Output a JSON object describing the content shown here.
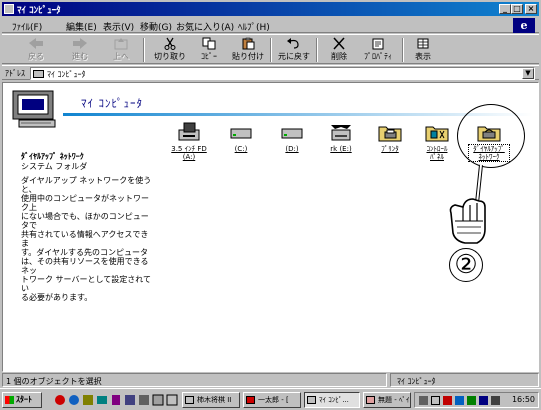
{
  "window": {
    "title": "ﾏｲ ｺﾝﾋﾟｭｰﾀ",
    "controls": {
      "minimize": "_",
      "maximize": "□",
      "close": "×"
    }
  },
  "menu": [
    "ﾌｧｲﾙ(F)",
    "編集(E)",
    "表示(V)",
    "移動(G)",
    "お気に入り(A)",
    "ﾍﾙﾌﾟ(H)"
  ],
  "toolbar": {
    "back": "戻る",
    "forward": "進む",
    "up": "上へ",
    "cut": "切り取り",
    "copy": "ｺﾋﾟｰ",
    "paste": "貼り付け",
    "undo": "元に戻す",
    "delete": "削除",
    "properties": "ﾌﾟﾛﾊﾟﾃｨ",
    "views": "表示"
  },
  "address": {
    "label": "ｱﾄﾞﾚｽ",
    "value": "ﾏｲ ｺﾝﾋﾟｭｰﾀ",
    "dropdown": "▼"
  },
  "content": {
    "title": "ﾏｲ ｺﾝﾋﾟｭｰﾀ",
    "info_title": "ﾀﾞｲﾔﾙｱｯﾌﾟ ﾈｯﾄﾜｰｸ",
    "info_sub": "システム フォルダ",
    "info_desc": "ダイヤルアップ ネットワークを使うと、\n使用中のコンピュータがネットワーク上\nにない場合でも、ほかのコンピュータで\n共有されている情報へアクセスできま\nす。ダイヤルする先のコンピュータ\nは、その共有リソースを使用できるネッ\nトワーク サーバーとして設定されてい\nる必要があります。",
    "items": [
      {
        "label": "3.5 ｲﾝﾁ FD\n(A:)",
        "icon": "floppy-drive-icon"
      },
      {
        "label": "(C:)",
        "icon": "hard-drive-icon"
      },
      {
        "label": "(D:)",
        "icon": "hard-drive-icon"
      },
      {
        "label": "rk (E:)",
        "icon": "cd-drive-icon"
      },
      {
        "label": "ﾌﾟﾘﾝﾀ",
        "icon": "printers-folder-icon"
      },
      {
        "label": "ｺﾝﾄﾛｰﾙ\nﾊﾟﾈﾙ",
        "icon": "control-panel-icon"
      },
      {
        "label": "ﾀﾞｲﾔﾙｱｯﾌﾟ\nﾈｯﾄﾜｰｸ",
        "icon": "dial-up-networking-icon"
      }
    ],
    "annotation_number": "②"
  },
  "status": {
    "left": "1 個のオブジェクトを選択",
    "right": "ﾏｲ ｺﾝﾋﾟｭｰﾀ"
  },
  "taskbar": {
    "start": "ｽﾀｰﾄ",
    "tasks": [
      "柿木将棋 II",
      "一太郎 - [",
      "ﾏｲ ｺﾝﾋﾟ...",
      "無題 - ﾍﾟｲ..."
    ],
    "clock": "16:50"
  },
  "colors": {
    "titlebar": "#000080",
    "desktop": "#c0c0c0",
    "header_title": "#000080"
  }
}
